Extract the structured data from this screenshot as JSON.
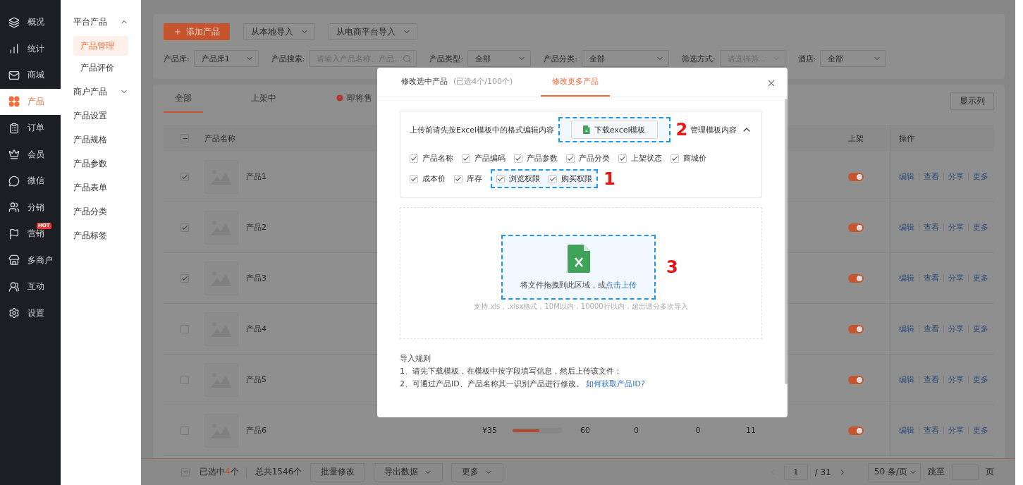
{
  "sidebar": {
    "items": [
      {
        "label": "概况",
        "selected": false
      },
      {
        "label": "统计",
        "selected": false
      },
      {
        "label": "商城",
        "selected": false
      },
      {
        "label": "产品",
        "selected": true
      },
      {
        "label": "订单",
        "selected": false
      },
      {
        "label": "会员",
        "selected": false
      },
      {
        "label": "微信",
        "selected": false
      },
      {
        "label": "分销",
        "selected": false
      },
      {
        "label": "营销",
        "selected": false,
        "badge": "HOT"
      },
      {
        "label": "多商户",
        "selected": false
      },
      {
        "label": "互动",
        "selected": false
      },
      {
        "label": "设置",
        "selected": false
      }
    ]
  },
  "subnav": {
    "items": [
      {
        "kind": "group",
        "label": "平台产品",
        "expanded": true,
        "children": [
          {
            "label": "产品管理",
            "selected": true
          },
          {
            "label": "产品评价",
            "selected": false
          }
        ]
      },
      {
        "kind": "group",
        "label": "商户产品",
        "expanded": false
      },
      {
        "kind": "link",
        "label": "产品设置",
        "selected": false
      },
      {
        "kind": "link",
        "label": "产品规格",
        "selected": false
      },
      {
        "kind": "link",
        "label": "产品参数",
        "selected": false
      },
      {
        "kind": "link",
        "label": "产品表单",
        "selected": false
      },
      {
        "kind": "link",
        "label": "产品分类",
        "selected": false
      },
      {
        "kind": "link",
        "label": "产品标签",
        "selected": false
      }
    ]
  },
  "toolbar": {
    "add_button": "添加产品",
    "import_menus": [
      "从本地导入",
      "从电商平台导入"
    ]
  },
  "filters": [
    {
      "kind": "select",
      "label": "产品库:",
      "value": "产品库1"
    },
    {
      "kind": "search",
      "label": "产品搜索:",
      "placeholder": "请输入产品名称、产品..."
    },
    {
      "kind": "select",
      "label": "产品类型:",
      "value": "全部"
    },
    {
      "kind": "select",
      "label": "产品分类:",
      "value": "全部"
    },
    {
      "kind": "select",
      "label": "筛选方式:",
      "placeholder": "请选择筛..."
    },
    {
      "kind": "select",
      "label": "酒店:",
      "value": "全部"
    }
  ],
  "tabs": [
    {
      "label": "全部",
      "selected": true,
      "warning": false
    },
    {
      "label": "上架中",
      "selected": false,
      "warning": false
    },
    {
      "label": "即将售",
      "selected": false,
      "warning": true
    }
  ],
  "columns_button": "显示列",
  "table": {
    "header": {
      "select_all_indeterminate": true,
      "name": "产品名称",
      "listed": "上架",
      "actions": "操作"
    },
    "rows": [
      {
        "checked": true,
        "name": "产品1",
        "listed": true,
        "actions": [
          "编辑",
          "查看",
          "分享",
          "更多"
        ]
      },
      {
        "checked": true,
        "name": "产品2",
        "listed": true,
        "actions": [
          "编辑",
          "查看",
          "分享",
          "更多"
        ]
      },
      {
        "checked": true,
        "name": "产品3",
        "listed": true,
        "actions": [
          "编辑",
          "查看",
          "分享",
          "更多"
        ]
      },
      {
        "checked": false,
        "name": "产品4",
        "listed": true,
        "actions": [
          "编辑",
          "查看",
          "分享",
          "更多"
        ]
      },
      {
        "checked": false,
        "name": "产品5",
        "listed": true,
        "actions": [
          "编辑",
          "查看",
          "分享",
          "更多"
        ]
      },
      {
        "checked": false,
        "name": "产品6",
        "listed": true,
        "cells": [
          "¥35",
          "60",
          "0",
          "0",
          "11"
        ],
        "actions": [
          "编辑",
          "查看",
          "分享",
          "更多"
        ]
      }
    ]
  },
  "footer": {
    "select_indeterminate": true,
    "selected": {
      "before": "已选中",
      "count": "4",
      "after": "个"
    },
    "total": "总共1546个",
    "batch_button": "批量修改",
    "menus": [
      "导出数据",
      "更多"
    ],
    "pagination": {
      "page": "1",
      "pages": "/ 31",
      "page_size": "50 条/页",
      "jump_label": "跳至",
      "page_suffix": "页"
    }
  },
  "modal": {
    "tabs": [
      {
        "label": "修改选中产品",
        "note": "(已选4个/100个)",
        "selected": false
      },
      {
        "label": "修改更多产品",
        "selected": true
      }
    ],
    "template": {
      "instruction": "上传前请先按Excel模板中的格式编辑内容",
      "download_button": "下载excel模板",
      "download_annotation": "2",
      "manage_label": "管理模板内容",
      "expanded": true,
      "field_rows": [
        [
          {
            "label": "产品名称",
            "checked": true
          },
          {
            "label": "产品编码",
            "checked": true
          },
          {
            "label": "产品参数",
            "checked": true
          },
          {
            "label": "产品分类",
            "checked": true
          },
          {
            "label": "上架状态",
            "checked": true
          },
          {
            "label": "商城价",
            "checked": true
          }
        ],
        [
          {
            "label": "成本价",
            "checked": true
          },
          {
            "label": "库存",
            "checked": true
          }
        ]
      ],
      "highlighted_fields": {
        "annotation": "1",
        "items": [
          {
            "label": "浏览权限",
            "checked": true
          },
          {
            "label": "购买权限",
            "checked": true
          }
        ]
      }
    },
    "upload": {
      "prompt": "将文件拖拽到此区域，或",
      "link": "点击上传",
      "annotation": "3",
      "hint": "支持.xls，.xlsx格式，10M以内，10000行以内，超出请分多次导入"
    },
    "rules": {
      "title": "导入规则",
      "lines": [
        {
          "text": "1、请先下载模板，在模板中按字段填写信息，然后上传该文件；"
        },
        {
          "text": "2、可通过产品ID、产品名称其一识别产品进行修改。",
          "link": "如何获取产品ID?"
        }
      ]
    }
  }
}
